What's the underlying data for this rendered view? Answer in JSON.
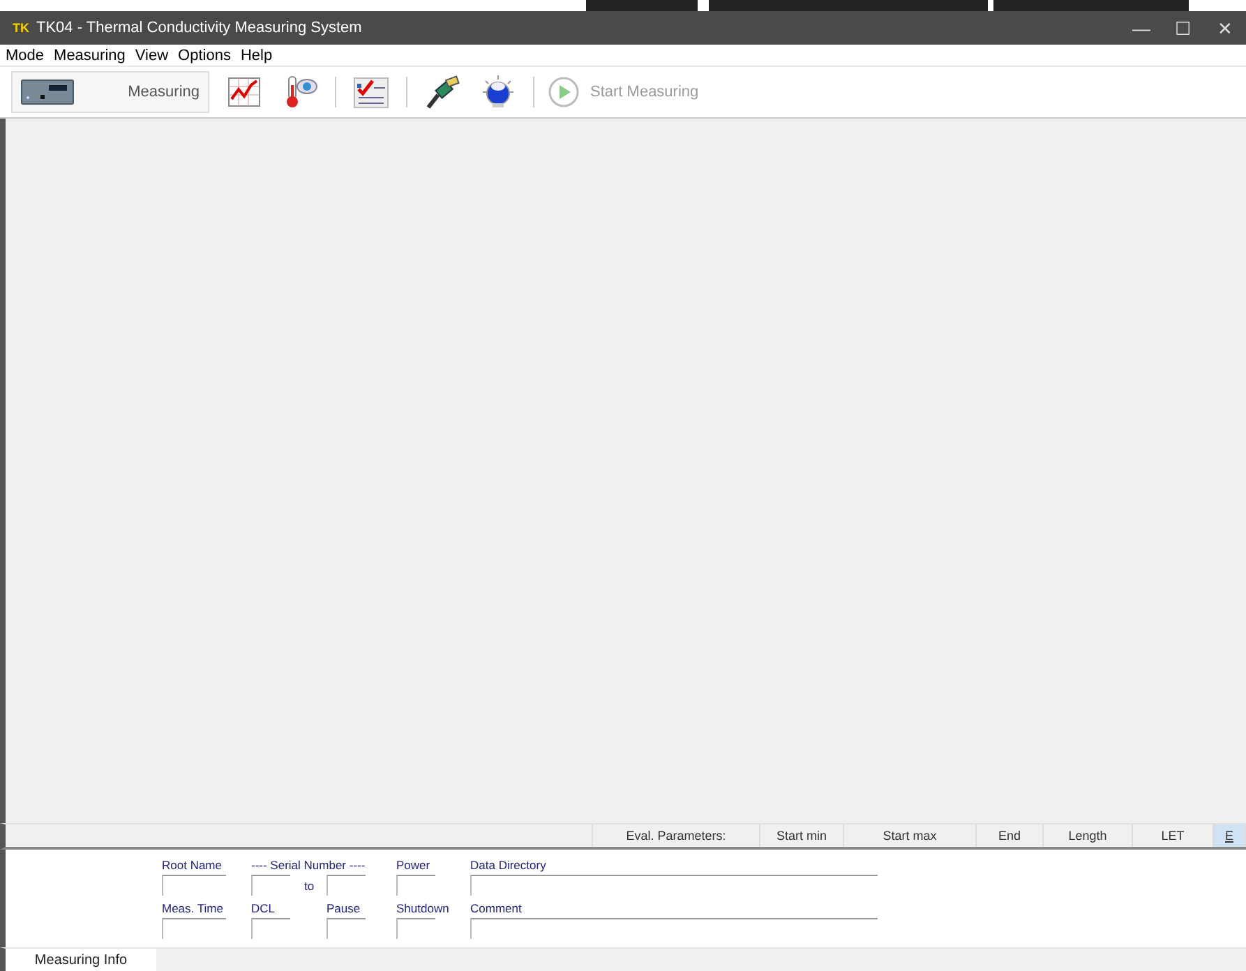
{
  "window": {
    "logo": "TK",
    "title": "TK04 - Thermal Conductivity Measuring System",
    "controls": [
      "—",
      "☐",
      "✕"
    ]
  },
  "menu": [
    "Mode",
    "Measuring",
    "View",
    "Options",
    "Help"
  ],
  "toolbar": [
    {
      "kind": "mode",
      "label": "Measuring",
      "selected": true
    },
    {
      "kind": "icon"
    },
    {
      "kind": "icon"
    },
    {
      "kind": "separator"
    },
    {
      "kind": "icon"
    },
    {
      "kind": "separator"
    },
    {
      "kind": "icon"
    },
    {
      "kind": "icon"
    },
    {
      "kind": "separator"
    },
    {
      "kind": "action",
      "label": "Start Measuring",
      "disabled": true
    }
  ],
  "eval_header": [
    "Eval. Parameters:",
    "Start min",
    "Start max",
    "End",
    "Length",
    "LET",
    "E"
  ],
  "form": {
    "root_name": "Root Name",
    "serial_number": "---- Serial Number ----",
    "serial_to": "to",
    "power": "Power",
    "data_directory": "Data Directory",
    "meas_time": "Meas. Time",
    "dcl": "DCL",
    "pause": "Pause",
    "shutdown": "Shutdown",
    "comment": "Comment"
  },
  "tabs": [
    {
      "label": "Measuring Info",
      "selected": true
    }
  ]
}
